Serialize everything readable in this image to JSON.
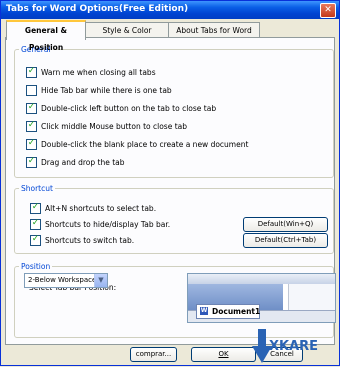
{
  "window": {
    "title": "Tabs for Word Options(Free Edition)",
    "close_glyph": "✕"
  },
  "tabs": [
    {
      "label": "General & Position"
    },
    {
      "label": "Style & Color"
    },
    {
      "label": "About Tabs for Word"
    }
  ],
  "general": {
    "legend": "General",
    "options": [
      {
        "label": "Warn me when closing all tabs",
        "checked": true
      },
      {
        "label": "Hide Tab bar while there is one tab",
        "checked": false
      },
      {
        "label": "Double-click left button on the tab to close tab",
        "checked": true
      },
      {
        "label": "Click middle Mouse button to close tab",
        "checked": true
      },
      {
        "label": "Double-click the blank place to create a new document",
        "checked": true
      },
      {
        "label": "Drag and drop the tab",
        "checked": true
      }
    ]
  },
  "shortcut": {
    "legend": "Shortcut",
    "options": [
      {
        "label": "Alt+N shortcuts to select tab.",
        "checked": true
      },
      {
        "label": "Shortcuts to hide/display Tab bar.",
        "checked": true,
        "button": "Default(Win+Q)"
      },
      {
        "label": "Shortcuts to switch tab.",
        "checked": true,
        "button": "Default(Ctrl+Tab)"
      }
    ]
  },
  "position": {
    "legend": "Position",
    "select_label": "Select Tab bar Position:",
    "select_value": "2-Below Workspace",
    "preview_tab": "Document1"
  },
  "footer": {
    "compare": "comprar...",
    "ok": "OK",
    "cancel": "Cancel"
  },
  "watermark": {
    "text": "XKARE"
  },
  "colors": {
    "accent": "#0046d5",
    "titlebar": "#0043d1",
    "check": "#21a121"
  }
}
